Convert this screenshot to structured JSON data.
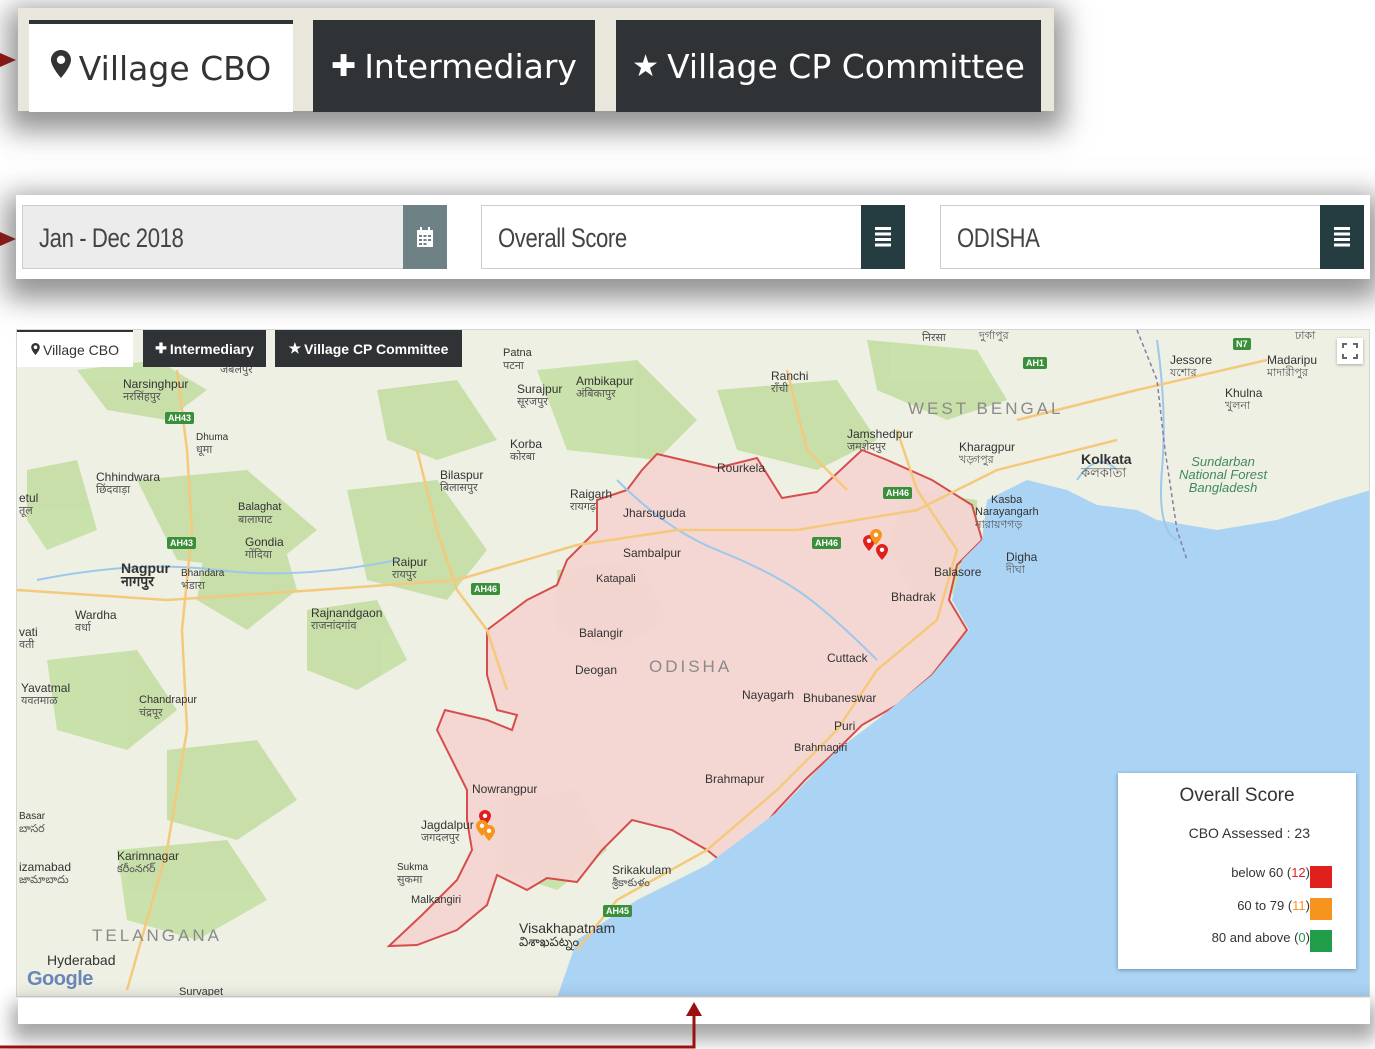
{
  "zoom_tabs": {
    "village_cbo": "Village CBO",
    "intermediary": "Intermediary",
    "village_cp_committee": "Village CP Committee"
  },
  "filters": {
    "date_range": "Jan - Dec 2018",
    "metric": "Overall Score",
    "state": "ODISHA"
  },
  "map": {
    "tabs": {
      "village_cbo": "Village CBO",
      "intermediary": "Intermediary",
      "village_cp_committee": "Village CP Committee"
    },
    "region_labels": {
      "west_bengal": "WEST BENGAL",
      "odisha": "ODISHA",
      "telangana": "TELANGANA"
    },
    "places": {
      "narsinghpur": "Narsinghpur",
      "narsinghpur_local": "नरसिंहपुर",
      "jabalpur_local": "जबलपुर",
      "patna": "Patna",
      "patna_local": "पटना",
      "ambikapur": "Ambikapur",
      "ambikapur_local": "अंबिकापुर",
      "surajpur": "Surajpur",
      "surajpur_local": "सूरजपुर",
      "ranchi": "Ranchi",
      "ranchi_local": "राँची",
      "jessore": "Jessore",
      "jessore_local": "যশোর",
      "madaripur": "Madaripu",
      "madaripur_local": "মাদারীপুর",
      "khulna": "Khulna",
      "khulna_local": "খুলনা",
      "dhuma": "Dhuma",
      "dhuma_local": "धूमा",
      "korba": "Korba",
      "korba_local": "कोरबा",
      "jamshedpur": "Jamshedpur",
      "jamshedpur_local": "जमशेदपुर",
      "kharagpur": "Kharagpur",
      "kharagpur_local": "খড়্গপুর",
      "kolkata": "Kolkata",
      "kolkata_local": "কলকাতা",
      "chhindwara": "Chhindwara",
      "chhindwara_local": "छिंदवाड़ा",
      "bilaspur": "Bilaspur",
      "bilaspur_local": "बिलासपुर",
      "raigarh": "Raigarh",
      "raigarh_local": "रायगढ़",
      "rourkela": "Rourkela",
      "sundarban": "Sundarban",
      "national_forest": "National Forest",
      "bangladesh": "Bangladesh",
      "betul": "etul",
      "betul_local": "तूल",
      "balaghat": "Balaghat",
      "balaghat_local": "बालाघाट",
      "jharsuguda": "Jharsuguda",
      "kasba": "Kasba",
      "narayangarh": "Narayangarh",
      "narayangarh_local": "নারায়ণগড়",
      "gondia": "Gondia",
      "gondia_local": "गोंदिया",
      "sambalpur": "Sambalpur",
      "digha": "Digha",
      "digha_local": "দীঘা",
      "nagpur": "Nagpur",
      "nagpur_local": "नागपुर",
      "bhandara": "Bhandara",
      "bhandara_local": "भंडारा",
      "raipur": "Raipur",
      "raipur_local": "रायपुर",
      "katapali": "Katapali",
      "balasore": "Balasore",
      "bhadrak": "Bhadrak",
      "wardha": "Wardha",
      "wardha_local": "वर्धा",
      "rajnandgaon": "Rajnandgaon",
      "rajnandgaon_local": "राजनांदगांव",
      "balangir": "Balangir",
      "amravati": "vati",
      "amravati_local": "वती",
      "deogan": "Deogan",
      "cuttack": "Cuttack",
      "yavatmal": "Yavatmal",
      "yavatmal_local": "यवतमाळ",
      "chandrapur": "Chandrapur",
      "chandrapur_local": "चंद्रपूर",
      "nayagarh": "Nayagarh",
      "bhubaneswar": "Bhubaneswar",
      "puri": "Puri",
      "brahmagiri": "Brahmagiri",
      "nowrangpur": "Nowrangpur",
      "brahmapur": "Brahmapur",
      "basar": "Basar",
      "basar_local": "బాసర",
      "jagdalpur": "Jagdalpur",
      "jagdalpur_local": "जगदलपुर",
      "karimnagar": "Karimnagar",
      "karimnagar_local": "కరీంనగర్",
      "nizamabad": "izamabad",
      "nizamabad_local": "జామాబాదు",
      "sukma": "Sukma",
      "sukma_local": "सुकमा",
      "srikakulam": "Srikakulam",
      "srikakulam_local": "శ్రీకాకుళం",
      "malkangiri": "Malkangiri",
      "visakhapatnam": "Visakhapatnam",
      "visakhapatnam_local": "విశాఖపట్నం",
      "hyderabad": "Hyderabad",
      "suryapet": "Survapet",
      "nirsa_local": "निरसा",
      "durgapur_local": "দুর্গাপুর",
      "dhaka": "Dhaka",
      "dhaka_local": "ঢাকা"
    },
    "highways": {
      "ah43a": "AH43",
      "ah43b": "AH43",
      "ah46a": "AH46",
      "ah46b": "AH46",
      "ah46c": "AH46",
      "ah45": "AH45",
      "ah1": "AH1",
      "n7": "N7"
    },
    "google_logo": "Google",
    "legend": {
      "title": "Overall Score",
      "subtitle": "CBO Assessed : 23",
      "items": [
        {
          "label": "below 60",
          "count": "12",
          "color": "#e0201d"
        },
        {
          "label": "60 to 79",
          "count": "11",
          "color": "#f7941d"
        },
        {
          "label": "80 and above",
          "count": "0",
          "color": "#1f9d49"
        }
      ]
    }
  },
  "colors": {
    "dark_button": "#2f3335",
    "date_button": "#6e8286",
    "filter_button": "#253c40",
    "odisha_fill": "#f5d5d2",
    "odisha_border": "#d44040",
    "water": "#aad3f4",
    "arrow": "#9b1010"
  }
}
